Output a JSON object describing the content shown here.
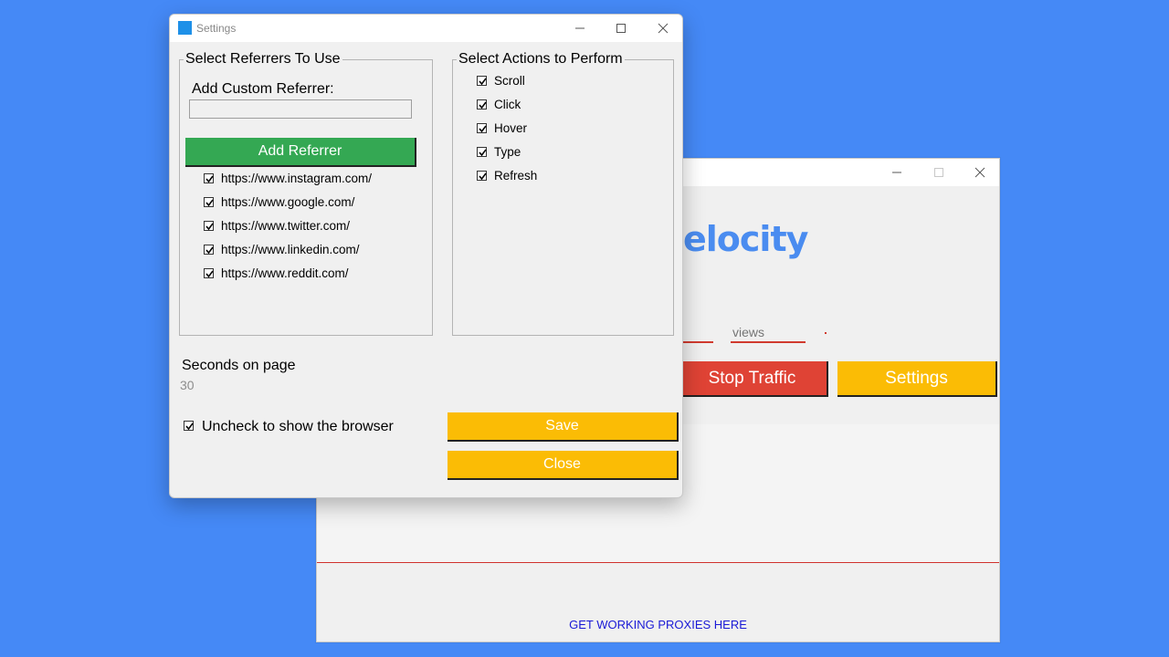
{
  "main_window": {
    "logo_text": "elocity",
    "views_placeholder": "views",
    "stop_label": "Stop Traffic",
    "settings_label": "Settings",
    "proxy_link": "GET WORKING PROXIES HERE"
  },
  "settings_dialog": {
    "title": "Settings",
    "referrers": {
      "legend": "Select Referrers To Use",
      "custom_label": "Add Custom Referrer:",
      "custom_value": "",
      "add_button": "Add Referrer",
      "items": [
        {
          "label": "https://www.instagram.com/",
          "checked": true
        },
        {
          "label": "https://www.google.com/",
          "checked": true
        },
        {
          "label": "https://www.twitter.com/",
          "checked": true
        },
        {
          "label": "https://www.linkedin.com/",
          "checked": true
        },
        {
          "label": "https://www.reddit.com/",
          "checked": true
        }
      ]
    },
    "actions": {
      "legend": "Select Actions to Perform",
      "items": [
        {
          "label": "Scroll",
          "checked": true
        },
        {
          "label": "Click",
          "checked": true
        },
        {
          "label": "Hover",
          "checked": true
        },
        {
          "label": "Type",
          "checked": true
        },
        {
          "label": "Refresh",
          "checked": true
        }
      ]
    },
    "seconds_label": "Seconds on page",
    "seconds_value": "30",
    "browser_checkbox_label": "Uncheck to show the browser",
    "browser_checked": true,
    "save_label": "Save",
    "close_label": "Close"
  },
  "colors": {
    "desktop": "#4589f6",
    "green": "#34a853",
    "yellow": "#fbbc05",
    "red": "#df4335",
    "logo_blue": "#4a8cf0"
  }
}
